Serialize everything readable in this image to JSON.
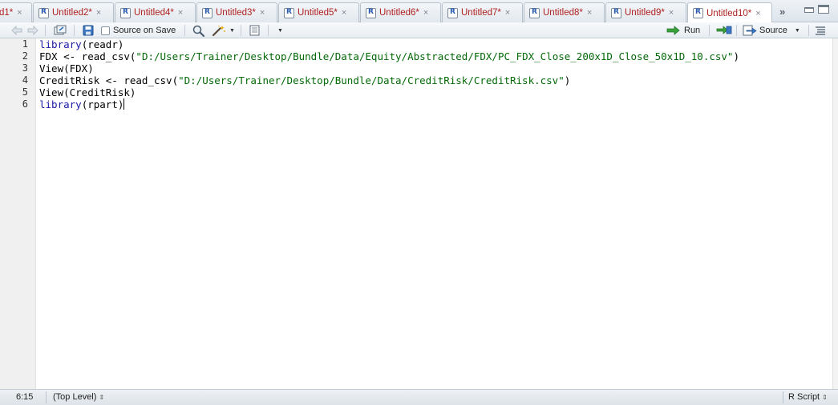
{
  "tabs": [
    {
      "label": "d1*",
      "close": "×",
      "active": false
    },
    {
      "label": "Untitled2*",
      "close": "×",
      "active": false
    },
    {
      "label": "Untitled4*",
      "close": "×",
      "active": false
    },
    {
      "label": "Untitled3*",
      "close": "×",
      "active": false
    },
    {
      "label": "Untitled5*",
      "close": "×",
      "active": false
    },
    {
      "label": "Untitled6*",
      "close": "×",
      "active": false
    },
    {
      "label": "Untitled7*",
      "close": "×",
      "active": false
    },
    {
      "label": "Untitled8*",
      "close": "×",
      "active": false
    },
    {
      "label": "Untitled9*",
      "close": "×",
      "active": false
    },
    {
      "label": "Untitled10*",
      "close": "×",
      "active": true
    }
  ],
  "tabbar": {
    "more_label": "»",
    "more_icon": "double-chevron-right-icon"
  },
  "toolbar": {
    "source_on_save_label": "Source on Save",
    "source_on_save_checked": false,
    "run_label": "Run",
    "source_label": "Source"
  },
  "editor": {
    "line_numbers": [
      "1",
      "2",
      "3",
      "4",
      "5",
      "6"
    ],
    "lines": {
      "l1_fn": "library",
      "l1_rest": "(readr)",
      "l2_pre": "FDX <- read_csv(",
      "l2_str": "\"D:/Users/Trainer/Desktop/Bundle/Data/Equity/Abstracted/FDX/PC_FDX_Close_200x1D_Close_50x1D_10.csv\"",
      "l2_post": ")",
      "l3": "View(FDX)",
      "l4_pre": "CreditRisk <- read_csv(",
      "l4_str": "\"D:/Users/Trainer/Desktop/Bundle/Data/CreditRisk/CreditRisk.csv\"",
      "l4_post": ")",
      "l5": "View(CreditRisk)",
      "l6_fn": "library",
      "l6_rest": "(rpart)"
    }
  },
  "status": {
    "cursor_position": "6:15",
    "scope": "(Top Level)",
    "file_type": "R Script",
    "updown_glyph": "⇕"
  },
  "colors": {
    "keyword": "#1a1aa6",
    "string": "#036a07",
    "tab_label": "#b02020"
  }
}
